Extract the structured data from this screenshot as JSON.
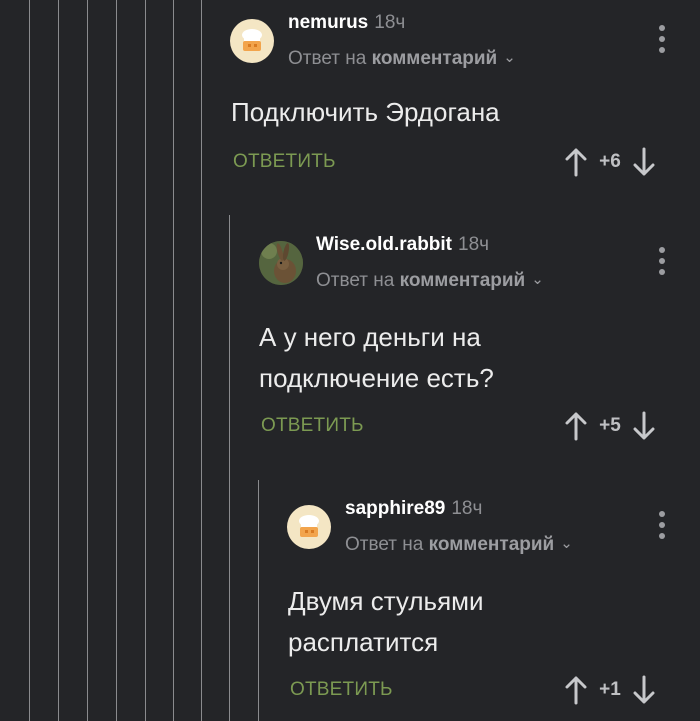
{
  "comments": [
    {
      "author": "nemurus",
      "time": "18ч",
      "reply_prefix": "Ответ на",
      "reply_target": "комментарий",
      "text": "Подключить Эрдогана",
      "reply_label": "ОТВЕТИТЬ",
      "score": "+6",
      "avatar": "chef-hat-avatar"
    },
    {
      "author": "Wise.old.rabbit",
      "time": "18ч",
      "reply_prefix": "Ответ на",
      "reply_target": "комментарий",
      "text_lines": [
        "А у него деньги на",
        "подключение есть?"
      ],
      "reply_label": "ОТВЕТИТЬ",
      "score": "+5",
      "avatar": "rabbit-photo-avatar"
    },
    {
      "author": "sapphire89",
      "time": "18ч",
      "reply_prefix": "Ответ на",
      "reply_target": "комментарий",
      "text_lines": [
        "Двумя стульями",
        "расплатится"
      ],
      "reply_label": "ОТВЕТИТЬ",
      "score": "+1",
      "avatar": "chef-hat-avatar"
    }
  ],
  "colors": {
    "background": "#242528",
    "reply_button": "#7c9a52",
    "thread_line": "#8a8b8e"
  }
}
